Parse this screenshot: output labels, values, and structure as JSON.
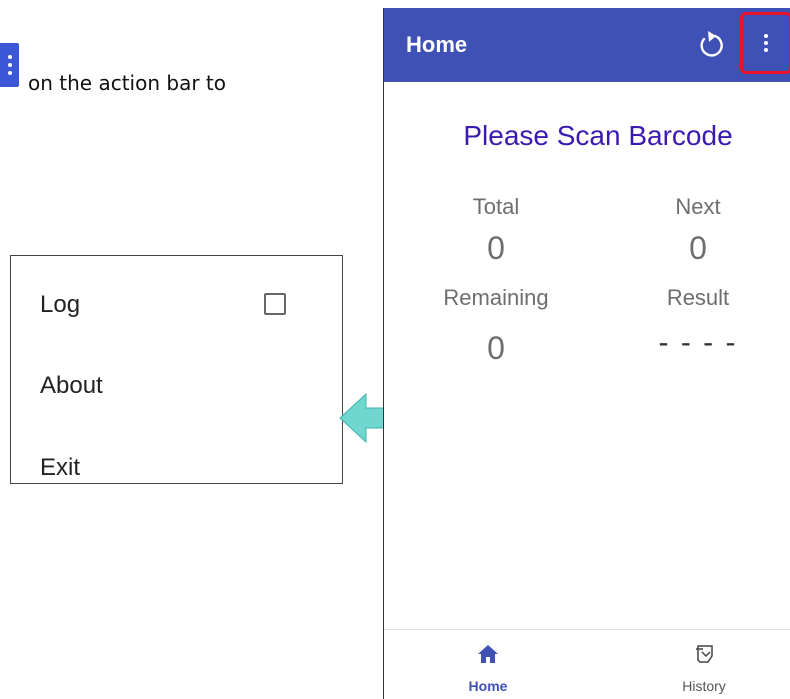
{
  "instruction": {
    "text": "on the action bar to",
    "chip_icon": "more-vert-icon"
  },
  "menu": {
    "items": [
      {
        "label": "Log",
        "has_checkbox": true,
        "checked": false
      },
      {
        "label": "About"
      },
      {
        "label": "Exit"
      }
    ]
  },
  "app": {
    "title": "Home",
    "refresh_icon": "refresh-icon",
    "overflow_icon": "more-vert-icon",
    "heading": "Please Scan Barcode",
    "stats": {
      "total_label": "Total",
      "total_value": "0",
      "next_label": "Next",
      "next_value": "0",
      "remaining_label": "Remaining",
      "remaining_value": "0",
      "result_label": "Result",
      "result_value": "- - - -"
    },
    "bottom_nav": [
      {
        "label": "Home",
        "icon": "home-icon",
        "active": true
      },
      {
        "label": "History",
        "icon": "history-icon",
        "active": false
      }
    ]
  },
  "colors": {
    "app_bar": "#3f51b5",
    "heading": "#3a1ab0",
    "highlight": "#e8132b",
    "arrow": "#6fd6d0",
    "nav_active": "#3f51b5"
  }
}
